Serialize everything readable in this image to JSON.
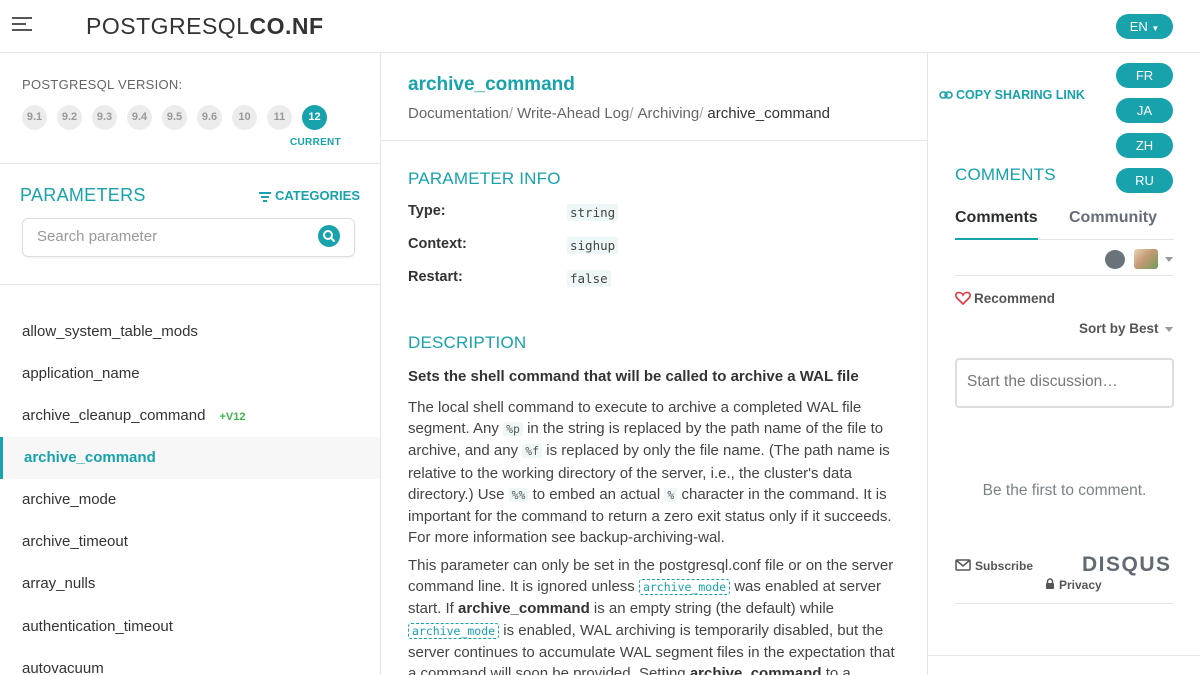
{
  "header": {
    "logo_light": "POSTGRESQL",
    "logo_bold": "CO.NF",
    "languages": [
      "EN",
      "FR",
      "JA",
      "ZH",
      "RU"
    ]
  },
  "sidebar": {
    "version_label": "POSTGRESQL VERSION:",
    "versions": [
      "9.1",
      "9.2",
      "9.3",
      "9.4",
      "9.5",
      "9.6",
      "10",
      "11",
      "12"
    ],
    "active_version": "12",
    "current_label": "CURRENT",
    "parameters_title": "PARAMETERS",
    "categories_label": "CATEGORIES",
    "search_placeholder": "Search parameter",
    "items": [
      {
        "label": "allow_system_table_mods"
      },
      {
        "label": "application_name"
      },
      {
        "label": "archive_cleanup_command",
        "badge": "+V12"
      },
      {
        "label": "archive_command",
        "active": true
      },
      {
        "label": "archive_mode"
      },
      {
        "label": "archive_timeout"
      },
      {
        "label": "array_nulls"
      },
      {
        "label": "authentication_timeout"
      },
      {
        "label": "autovacuum"
      }
    ]
  },
  "main": {
    "title": "archive_command",
    "breadcrumb": [
      "Documentation",
      "Write-Ahead Log",
      "Archiving",
      "archive_command"
    ],
    "copy_link_label": "COPY SHARING LINK",
    "info_title": "PARAMETER INFO",
    "info": [
      {
        "key": "Type:",
        "value": "string"
      },
      {
        "key": "Context:",
        "value": "sighup"
      },
      {
        "key": "Restart:",
        "value": "false"
      }
    ],
    "description_title": "DESCRIPTION",
    "summary": "Sets the shell command that will be called to archive a WAL file",
    "p1": {
      "t1": "The local shell command to execute to archive a completed WAL file segment. Any ",
      "c1": "%p",
      "t2": " in the string is replaced by the path name of the file to archive, and any ",
      "c2": "%f",
      "t3": " is replaced by only the file name. (The path name is relative to the working directory of the server, i.e., the cluster's data directory.) Use ",
      "c3": "%%",
      "t4": " to embed an actual ",
      "c4": "%",
      "t5": " character in the command. It is important for the command to return a zero exit status only if it succeeds. For more information see backup-archiving-wal."
    },
    "p2": {
      "t1": "This parameter can only be set in the postgresql.conf file or on the server command line. It is ignored unless ",
      "l1": "archive_mode",
      "t2": " was enabled at server start. If ",
      "b1": "archive_command",
      "t3": " is an empty string (the default) while ",
      "l2": "archive_mode",
      "t4": " is enabled, WAL archiving is temporarily disabled, but the server continues to accumulate WAL segment files in the expectation that a command will soon be provided. Setting ",
      "b2": "archive_command",
      "t5": " to a"
    }
  },
  "comments": {
    "title": "COMMENTS",
    "tabs": [
      "Comments",
      "Community"
    ],
    "recommend_label": "Recommend",
    "sort_label": "Sort by Best",
    "input_placeholder": "Start the discussion…",
    "empty_text": "Be the first to comment.",
    "subscribe_label": "Subscribe",
    "brand": "DISQUS",
    "privacy_label": "Privacy"
  },
  "colors": {
    "accent": "#17a2ac",
    "badge_green": "#3cb64a"
  }
}
